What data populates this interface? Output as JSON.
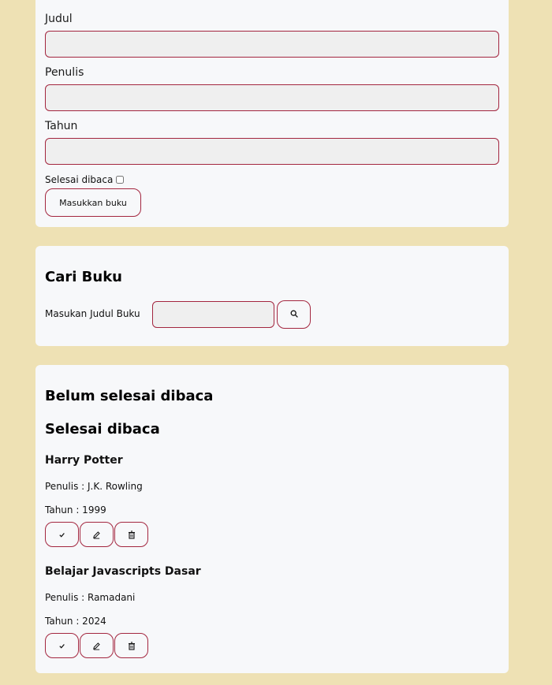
{
  "form": {
    "title_label": "Judul",
    "author_label": "Penulis",
    "year_label": "Tahun",
    "title_value": "",
    "author_value": "",
    "year_value": "",
    "finished_label": "Selesai dibaca",
    "finished_checked": false,
    "submit_label": "Masukkan buku"
  },
  "search": {
    "heading": "Cari Buku",
    "label": "Masukan Judul Buku",
    "value": "",
    "button_icon": "search-icon"
  },
  "shelf": {
    "unread_heading": "Belum selesai dibaca",
    "read_heading": "Selesai dibaca",
    "books": [
      {
        "title": "Harry Potter",
        "author": "Penulis : J.K. Rowling",
        "year": "Tahun : 1999"
      },
      {
        "title": "Belajar Javascripts Dasar",
        "author": "Penulis : Ramadani",
        "year": "Tahun : 2024"
      }
    ],
    "actions": [
      "check-icon",
      "pencil-icon",
      "trash-icon"
    ]
  },
  "colors": {
    "background": "#eee1b4",
    "card": "#f7f8fa",
    "accent_border": "#a3263f",
    "input_fill": "#efefef"
  }
}
